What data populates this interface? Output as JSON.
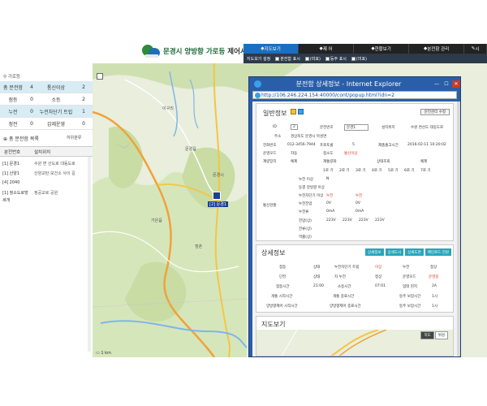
{
  "header": {
    "logo_text_green": "문경시 양방향 가로등",
    "logo_text_dark": "제어시스템"
  },
  "topnav": {
    "items": [
      "지도보기",
      "제 어",
      "현황보기",
      "분전함 관리",
      "시"
    ]
  },
  "subnav": {
    "label": "지도보기 설정",
    "toggles": [
      "분전함 표시",
      "(미표)",
      "등주 표시",
      "(미표)"
    ]
  },
  "left": {
    "search_placeholder": "가로등",
    "stats": [
      {
        "k": "총 분전함",
        "v": "4",
        "k2": "통신이상",
        "v2": "2"
      },
      {
        "k": "점등",
        "v": "0",
        "k2": "소등",
        "v2": "2"
      },
      {
        "k": "누전",
        "v": "0",
        "k2": "누전차단기 트립",
        "v2": "1"
      },
      {
        "k": "정전",
        "v": "0",
        "k2": "갑제운영",
        "v2": "0"
      }
    ],
    "list_title": "총 분전함 목록",
    "list_more": "하위분류",
    "list_headers": [
      "분전번호",
      "설치위치"
    ],
    "list_rows": [
      {
        "c1": "[1] 문경1",
        "c2": "수원 면 산도로 대동도로"
      },
      {
        "c1": "[1] 산양1",
        "c2": "산양교탄 보건소 사이 길"
      },
      {
        "c1": "[4] 2040",
        "c2": ""
      },
      {
        "c1": "[1] 정소도로방",
        "c2": "정공교로 공원"
      },
      {
        "c1": "세개",
        "c2": ""
      }
    ]
  },
  "map": {
    "marker_label": "[2] 문경1",
    "labels": [
      "가은읍",
      "문경읍",
      "점촌",
      "문경시",
      "이구리"
    ],
    "scale": "1 km"
  },
  "popup": {
    "title": "분전함 상세정보 - Internet Explorer",
    "address": "http://106.246.224.154:40000/cont/popup.html?idn=2",
    "address_bold": "106.246.224.154",
    "section1": {
      "title": "일반정보",
      "button": "분전관리 수정",
      "row1": [
        "ID",
        "2",
        "분전번호",
        "문경1",
        "설치위치",
        "수원 면산도 대동도로"
      ],
      "row2": [
        "주소",
        "경상북도 문경시 마성면"
      ],
      "row3": [
        "전화번호",
        "012-3456-7944",
        "프로토콜",
        "5",
        "제품출고시간",
        "2016-02-11 10:20:02"
      ],
      "row4": [
        "운영모드",
        "자동",
        "점소도",
        "통신이상"
      ],
      "row5": [
        "계량장치",
        "예제",
        "계통량화",
        "",
        "상태조회",
        "",
        "",
        "예제"
      ],
      "row6": [
        "1로 기",
        "2로 기",
        "3로 기",
        "4로 기",
        "5로 기",
        "6로 기",
        "7로 기"
      ],
      "row7": [
        "누전 이상",
        "N"
      ],
      "row8": [
        "동결 양방향 이상"
      ],
      "row9": [
        "누전차단기 이상",
        "누전",
        "누전"
      ],
      "row10": [
        "누전전압",
        "0V",
        "0V"
      ],
      "row11": [
        "누전류",
        "0mA",
        "0mA"
      ],
      "row12": [
        "전압(상)",
        "223V",
        "223V",
        "223V",
        "223V"
      ],
      "row13": [
        "전류(상)"
      ],
      "row14": [
        "역률(상)"
      ],
      "side_label": "통신현황"
    },
    "section2": {
      "title": "상세정보",
      "tabs": [
        "상세정보",
        "상세도시",
        "상세도면",
        "메인로드 전원"
      ],
      "rows": [
        [
          "점등",
          "상태",
          "누전차단기 트립",
          "이상",
          "누전",
          "정상"
        ],
        [
          "단전",
          "상태",
          "차 누전",
          "정상",
          "운영모드",
          "운영중"
        ],
        [
          "점등시간",
          "21:00",
          "소등시간",
          "07:01",
          "업데 현지",
          "2A"
        ],
        [
          "개통 시작시간",
          "",
          "개통 종료시간",
          "",
          "등주 보압시간",
          "1시"
        ],
        [
          "양방향제어 시작시간",
          "",
          "양방향제어 종료시간",
          "",
          "등주 보압시간",
          "1시"
        ]
      ]
    },
    "section3": {
      "title": "지도보기",
      "buttons": [
        "지도",
        "위성"
      ]
    }
  }
}
